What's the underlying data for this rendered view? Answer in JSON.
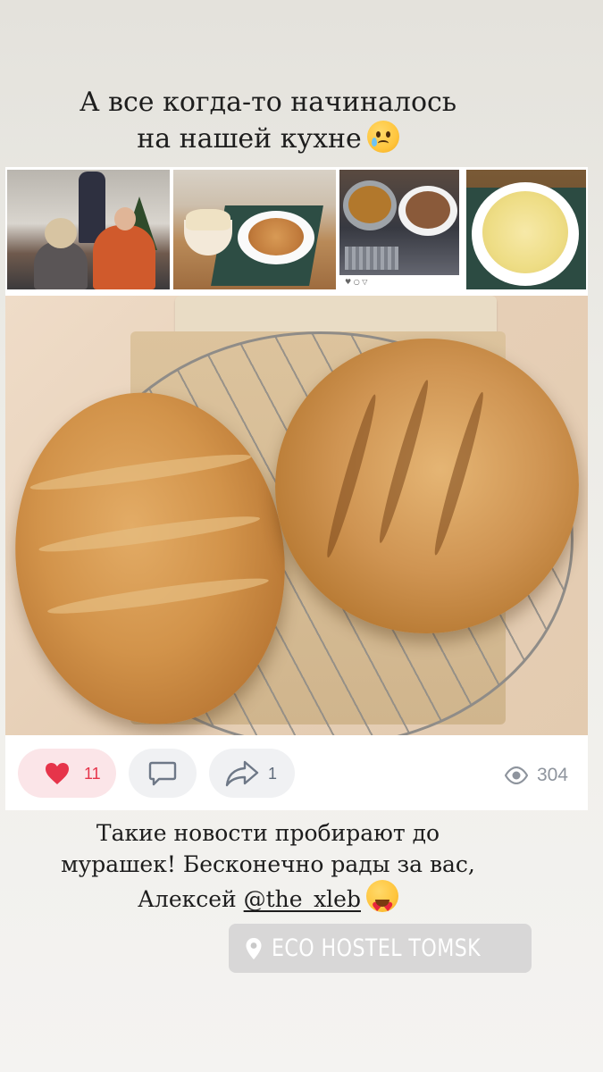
{
  "story_text": {
    "line1": "А все когда-то начиналось",
    "line2": "на нашей кухне",
    "emoji": "crying-face-emoji"
  },
  "post": {
    "thumbnail_strip": [
      "people-at-table-photo",
      "pilaf-plate-photo",
      "soup-and-pilaf-photo",
      "salad-plate-photo"
    ],
    "thumbnail_icons": "♥ ○ ▽",
    "main_photo": "bread-loaves-photo",
    "likes": "11",
    "shares": "1",
    "views": "304",
    "accent_like": "#e6344a",
    "like_pill_bg": "#fbe5e8"
  },
  "caption": {
    "line1": "Такие новости пробирают до",
    "line2": "мурашек! Бесконечно рады за вас,",
    "line3_prefix": "Алексей ",
    "mention": "@the_xleb",
    "emoji": "heart-eyes-emoji"
  },
  "location_sticker": {
    "icon": "location-pin-icon",
    "text": "ECO HOSTEL TOMSK"
  }
}
